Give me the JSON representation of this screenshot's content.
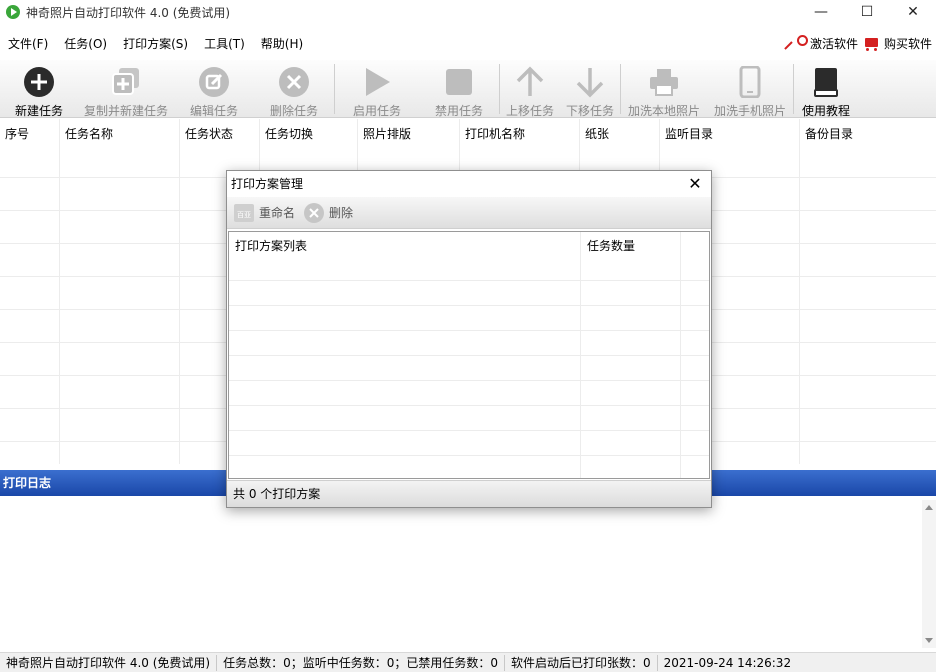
{
  "window": {
    "title": "神奇照片自动打印软件 4.0 (免费试用)",
    "minimize": "—",
    "maximize": "☐",
    "close": "✕"
  },
  "menu": {
    "items": [
      "文件(F)",
      "任务(O)",
      "打印方案(S)",
      "工具(T)",
      "帮助(H)"
    ],
    "activate": "激活软件",
    "buy": "购买软件"
  },
  "toolbar": {
    "new_task": "新建任务",
    "copy_task": "复制并新建任务",
    "edit_task": "编辑任务",
    "delete_task": "删除任务",
    "enable_task": "启用任务",
    "disable_task": "禁用任务",
    "move_up": "上移任务",
    "move_down": "下移任务",
    "add_local": "加洗本地照片",
    "add_phone": "加洗手机照片",
    "tutorial": "使用教程"
  },
  "grid": {
    "columns": [
      "序号",
      "任务名称",
      "任务状态",
      "任务切换",
      "照片排版",
      "打印机名称",
      "纸张",
      "监听目录",
      "备份目录"
    ]
  },
  "log": {
    "title": "打印日志"
  },
  "status": {
    "app": "神奇照片自动打印软件 4.0 (免费试用)",
    "tasks": "任务总数：0；监听中任务数：0；已禁用任务数：0",
    "printed": "软件启动后已打印张数：0",
    "datetime": "2021-09-24 14:26:32"
  },
  "dialog": {
    "title": "打印方案管理",
    "close": "✕",
    "rename": "重命名",
    "delete": "删除",
    "rename_icon_text": "百亚",
    "columns": [
      "打印方案列表",
      "任务数量"
    ],
    "footer": "共 0 个打印方案"
  },
  "colors": {
    "log_header": "#1a47a8",
    "accent_red": "#d42020",
    "toolbar_dark": "#2b2b2b",
    "toolbar_disabled": "#bdbdbd"
  }
}
